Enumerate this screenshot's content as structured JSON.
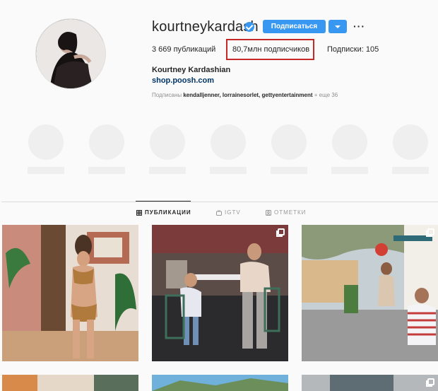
{
  "profile": {
    "username": "kourtneykardash",
    "follow_label": "Подписаться",
    "more_label": "···",
    "posts_count": "3 669",
    "posts_label": "публикаций",
    "followers_count": "80,7млн",
    "followers_label": "подписчиков",
    "following_label": "Подписки:",
    "following_count": "105",
    "full_name": "Kourtney Kardashian",
    "website": "shop.poosh.com",
    "followed_by_prefix": "Подписаны",
    "followed_by_users": "kendalljenner, lorrainesorlet, gettyentertainment",
    "followed_by_more": "+ еще 36"
  },
  "tabs": [
    {
      "label": "ПУБЛИКАЦИИ",
      "icon": "grid-icon"
    },
    {
      "label": "IGTV",
      "icon": "igtv-icon"
    },
    {
      "label": "ОТМЕТКИ",
      "icon": "tagged-icon"
    }
  ],
  "colors": {
    "accent": "#3897f0",
    "highlight": "#c62828",
    "link": "#003569"
  }
}
